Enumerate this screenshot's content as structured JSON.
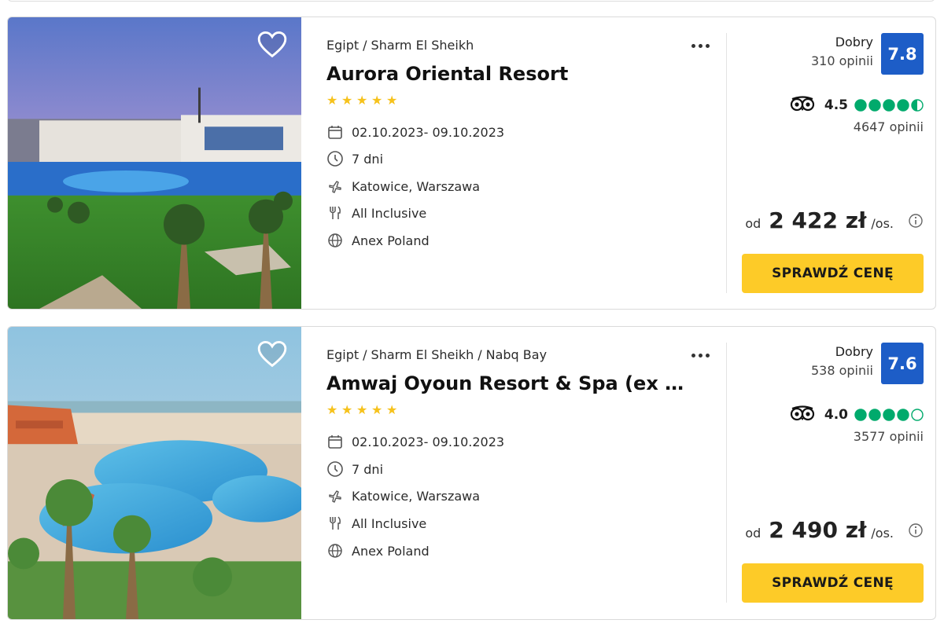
{
  "offers": [
    {
      "breadcrumb": [
        "Egipt",
        "Sharm El Sheikh"
      ],
      "breadcrumb_sep": "/",
      "name": "Aurora Oriental Resort",
      "stars": 5,
      "dates": "02.10.2023- 09.10.2023",
      "duration": "7 dni",
      "departure": "Katowice, Warszawa",
      "board": "All Inclusive",
      "operator": "Anex Poland",
      "rating_word": "Dobry",
      "rating_count": "310 opinii",
      "rating_score": "7.8",
      "tripadvisor_score": "4.5",
      "tripadvisor_rating": 4.5,
      "tripadvisor_count": "4647 opinii",
      "price_prefix": "od",
      "price": "2 422 zł",
      "price_suffix": "/os.",
      "cta_label": "SPRAWDŹ CENĘ"
    },
    {
      "breadcrumb": [
        "Egipt",
        "Sharm El Sheikh",
        "Nabq Bay"
      ],
      "breadcrumb_sep": "/",
      "name": "Amwaj Oyoun Resort & Spa (ex AA A…",
      "stars": 5,
      "dates": "02.10.2023- 09.10.2023",
      "duration": "7 dni",
      "departure": "Katowice, Warszawa",
      "board": "All Inclusive",
      "operator": "Anex Poland",
      "rating_word": "Dobry",
      "rating_count": "538 opinii",
      "rating_score": "7.6",
      "tripadvisor_score": "4.0",
      "tripadvisor_rating": 4.0,
      "tripadvisor_count": "3577 opinii",
      "price_prefix": "od",
      "price": "2 490 zł",
      "price_suffix": "/os.",
      "cta_label": "SPRAWDŹ CENĘ"
    }
  ],
  "icons": {
    "favorite": "heart-outline-icon",
    "more": "more-dots-icon",
    "dates": "calendar-icon",
    "duration": "clock-icon",
    "departure": "plane-icon",
    "board": "cutlery-icon",
    "operator": "globe-icon",
    "tripadvisor": "tripadvisor-owl-icon",
    "price_info": "info-icon"
  },
  "colors": {
    "rating_badge": "#1d5dc7",
    "star": "#f6c21c",
    "tripadvisor_green": "#00aa6c",
    "cta": "#fdcb28"
  }
}
